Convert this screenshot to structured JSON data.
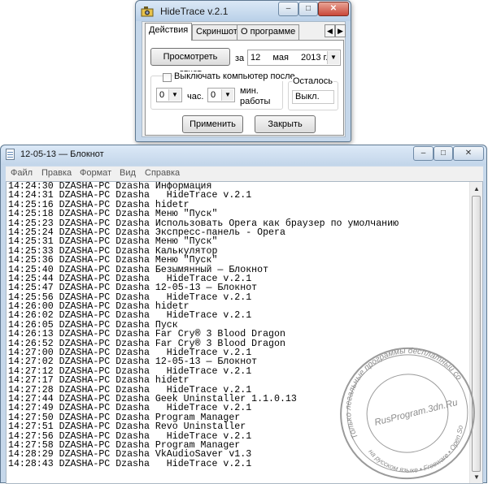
{
  "hidetrace": {
    "title": "HideTrace v.2.1",
    "window_controls": {
      "minimize": "‒",
      "maximize": "□",
      "close": "✕"
    },
    "tabs": [
      "Действия",
      "Скриншот",
      "О программе"
    ],
    "tab_scroll": {
      "left": "◀",
      "right": "▶"
    },
    "view_report_button": "Просмотреть отчет",
    "for_label": "за",
    "date": {
      "day": "12",
      "month": "мая",
      "year": "2013 г."
    },
    "shutdown": {
      "checkbox_label": "Выключать компьютер после",
      "checked": false,
      "hours_value": "0",
      "hours_label": "час.",
      "minutes_value": "0",
      "minutes_label": "мин.",
      "work_label": "работы",
      "remaining_label": "Осталось",
      "remaining_value": "Выкл."
    },
    "apply_button": "Применить",
    "close_button": "Закрыть"
  },
  "notepad": {
    "title": "12-05-13 — Блокнот",
    "window_controls": {
      "minimize": "‒",
      "maximize": "□",
      "close": "✕"
    },
    "menu": [
      "Файл",
      "Правка",
      "Формат",
      "Вид",
      "Справка"
    ],
    "lines": [
      "14:24:30 DZASHA-PC Dzasha Информация",
      "14:24:31 DZASHA-PC Dzasha   HideTrace v.2.1",
      "14:25:16 DZASHA-PC Dzasha hidetr",
      "14:25:18 DZASHA-PC Dzasha Меню \"Пуск\"",
      "14:25:23 DZASHA-PC Dzasha Использовать Opera как браузер по умолчанию",
      "14:25:24 DZASHA-PC Dzasha Экспресс-панель - Opera",
      "14:25:31 DZASHA-PC Dzasha Меню \"Пуск\"",
      "14:25:33 DZASHA-PC Dzasha Калькулятор",
      "14:25:36 DZASHA-PC Dzasha Меню \"Пуск\"",
      "14:25:40 DZASHA-PC Dzasha Безымянный — Блокнот",
      "14:25:44 DZASHA-PC Dzasha   HideTrace v.2.1",
      "14:25:47 DZASHA-PC Dzasha 12-05-13 — Блокнот",
      "14:25:56 DZASHA-PC Dzasha   HideTrace v.2.1",
      "14:26:00 DZASHA-PC Dzasha hidetr",
      "14:26:02 DZASHA-PC Dzasha   HideTrace v.2.1",
      "14:26:05 DZASHA-PC Dzasha Пуск",
      "14:26:13 DZASHA-PC Dzasha Far Cry® 3 Blood Dragon",
      "14:26:52 DZASHA-PC Dzasha Far Cry® 3 Blood Dragon",
      "14:27:00 DZASHA-PC Dzasha   HideTrace v.2.1",
      "14:27:02 DZASHA-PC Dzasha 12-05-13 — Блокнот",
      "14:27:12 DZASHA-PC Dzasha   HideTrace v.2.1",
      "14:27:17 DZASHA-PC Dzasha hidetr",
      "14:27:28 DZASHA-PC Dzasha   HideTrace v.2.1",
      "14:27:44 DZASHA-PC Dzasha Geek Uninstaller 1.1.0.13",
      "14:27:49 DZASHA-PC Dzasha   HideTrace v.2.1",
      "14:27:50 DZASHA-PC Dzasha Program Manager",
      "14:27:51 DZASHA-PC Dzasha Revo Uninstaller",
      "14:27:56 DZASHA-PC Dzasha   HideTrace v.2.1",
      "14:27:58 DZASHA-PC Dzasha Program Manager",
      "14:28:29 DZASHA-PC Dzasha VkAudioSaver v1.3",
      "14:28:43 DZASHA-PC Dzasha   HideTrace v.2.1"
    ],
    "scrollbar": {
      "up": "▲",
      "down": "▼"
    }
  },
  "watermark": {
    "outer_text": "Только легальные программы бесплатный софт",
    "center_text": "RusProgram.3dn.Ru",
    "bottom_text": "на русском языке • Freeware • Open Source"
  }
}
